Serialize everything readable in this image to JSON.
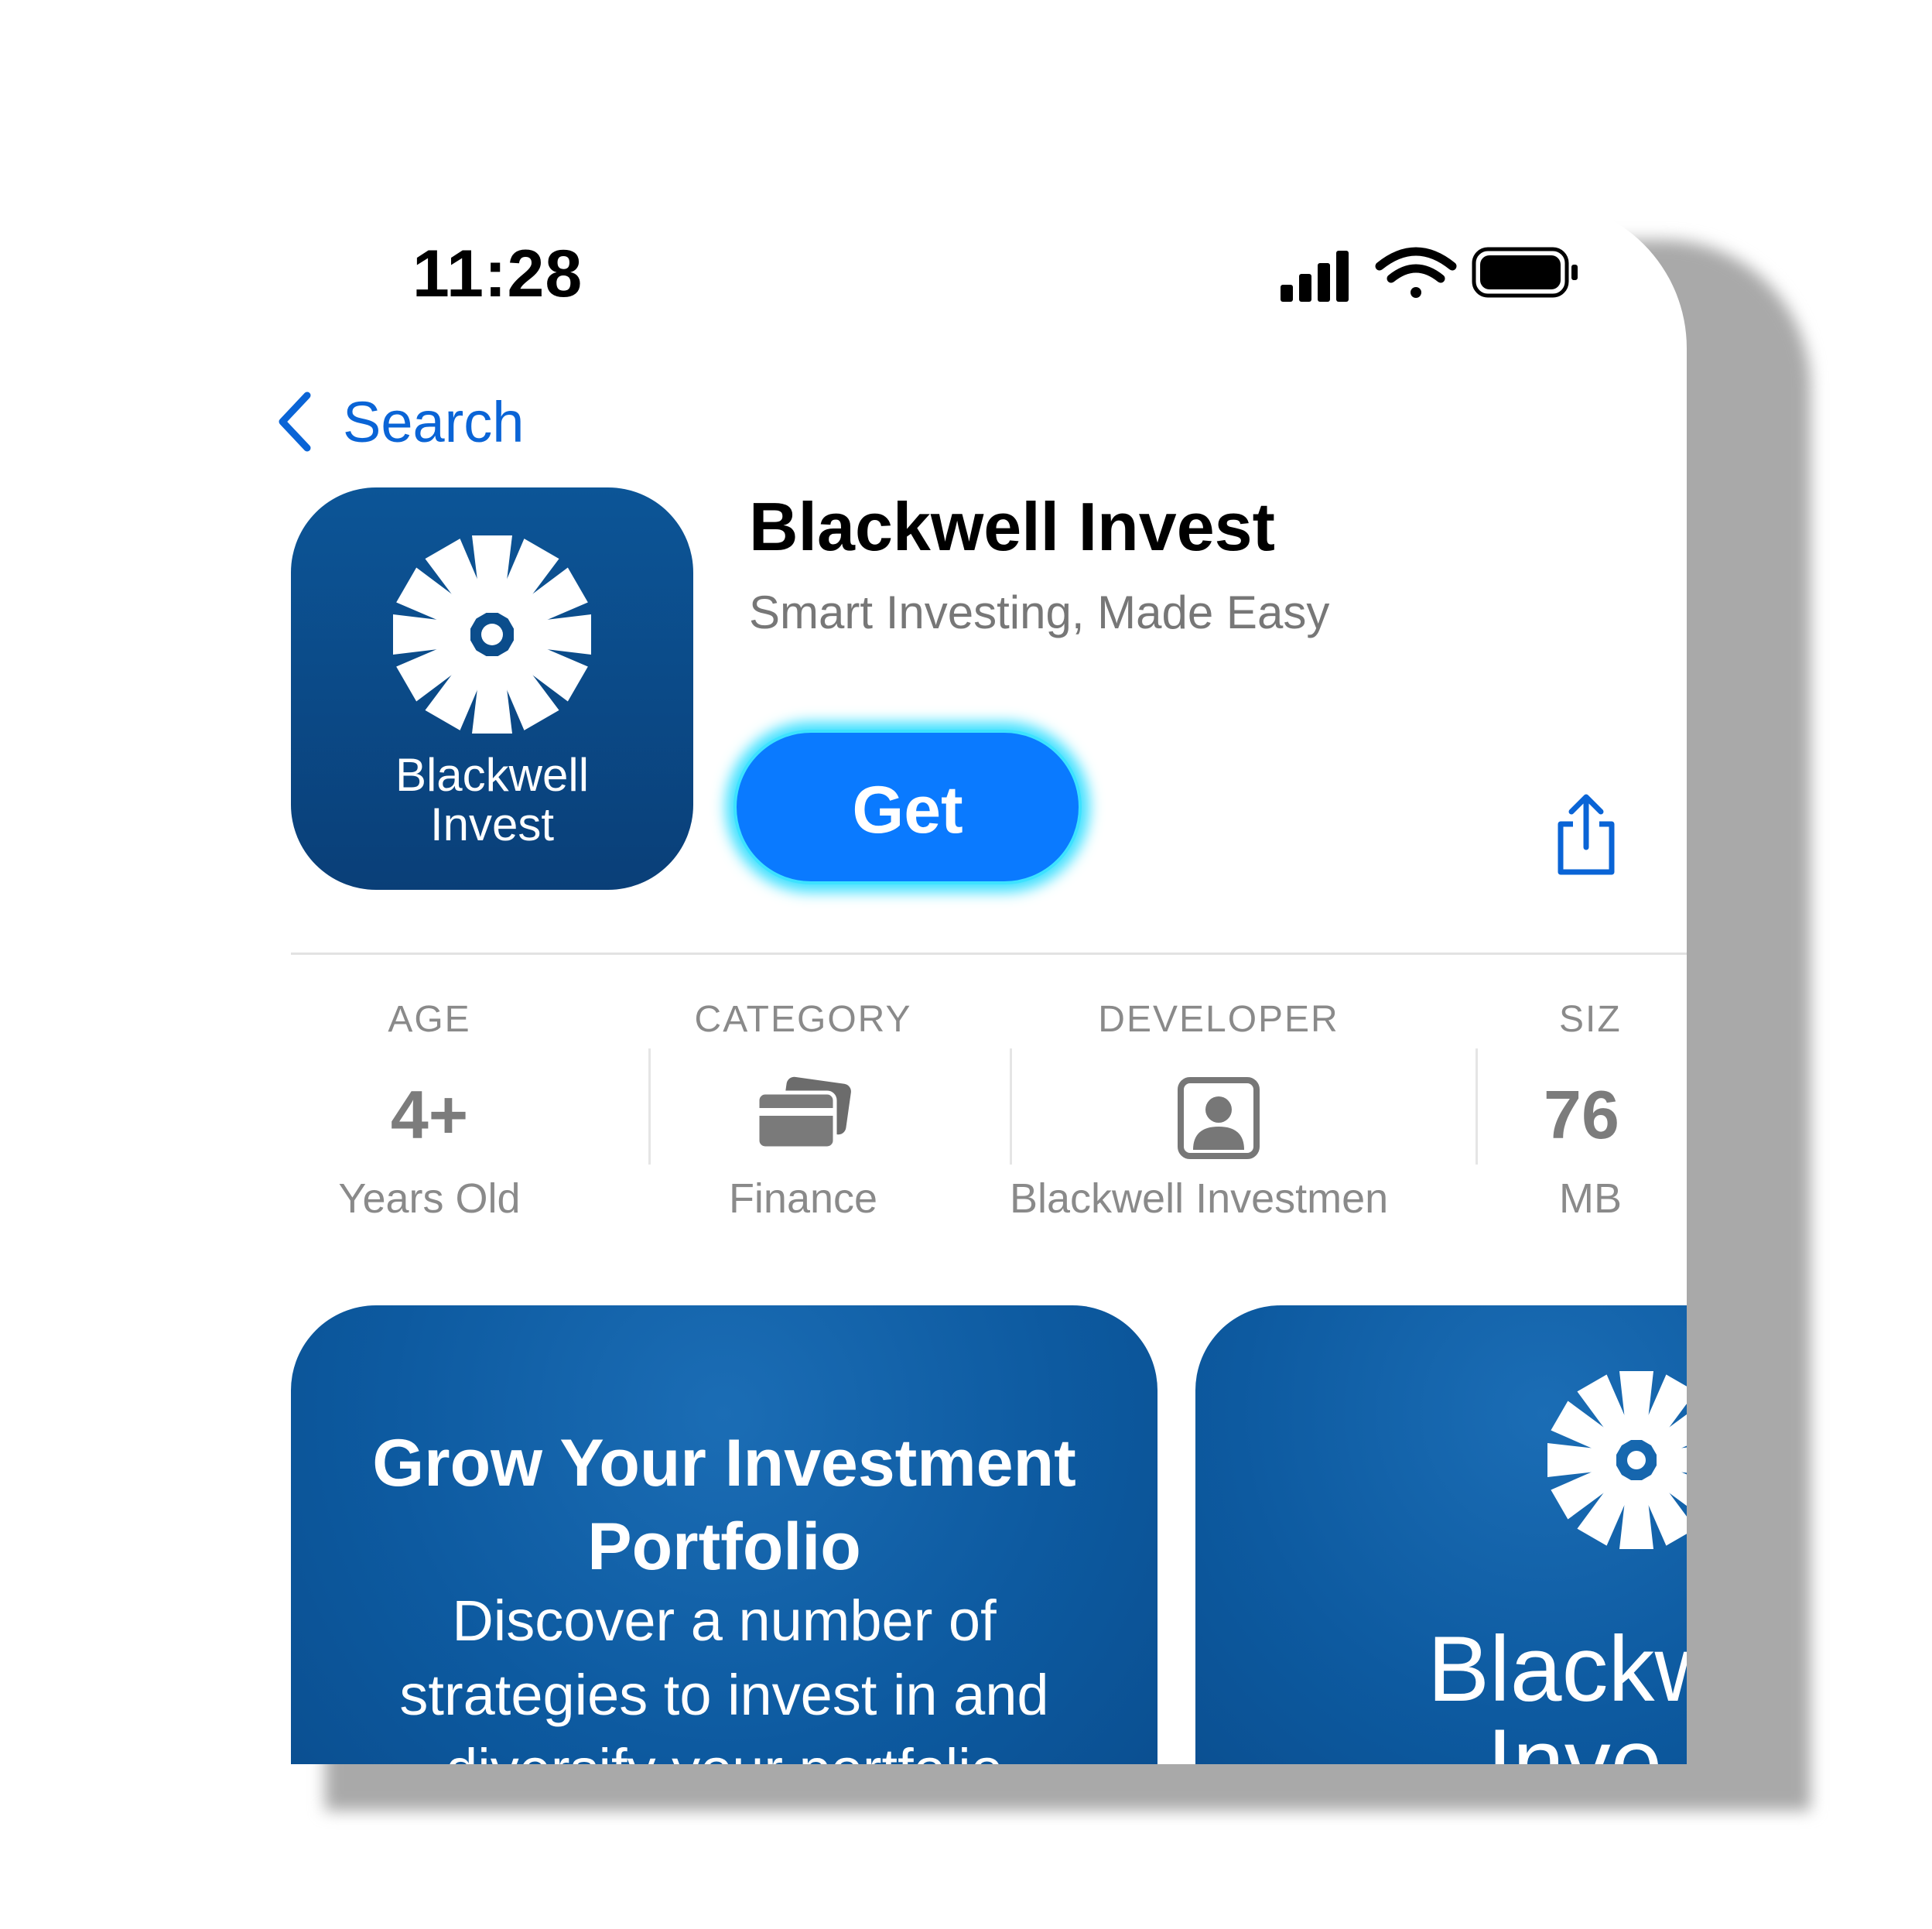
{
  "status_bar": {
    "time": "11:28"
  },
  "nav": {
    "back_label": "Search"
  },
  "app": {
    "name": "Blackwell Invest",
    "subtitle": "Smart Investing, Made Easy",
    "get_label": "Get",
    "icon_line1": "Blackwell",
    "icon_line2": "Invest"
  },
  "info": [
    {
      "label": "AGE",
      "value": "4+",
      "sub": "Years Old"
    },
    {
      "label": "CATEGORY",
      "icon": "cards-icon",
      "sub": "Finance"
    },
    {
      "label": "DEVELOPER",
      "icon": "person-icon",
      "sub": "Blackwell Investmen"
    },
    {
      "label": "SIZ",
      "value": "76",
      "sub": "MB"
    }
  ],
  "screenshots": [
    {
      "title_line1": "Grow Your Investment",
      "title_line2": "Portfolio",
      "body_line1": "Discover a number of",
      "body_line2": "strategies to invest in and",
      "body_line3": "diversify your portfolio"
    },
    {
      "logo_line1": "Blackw",
      "logo_line2": "Inve"
    }
  ],
  "colors": {
    "accent": "#0a7aff",
    "link": "#0a64d6",
    "icon_bg": "#0c5597"
  }
}
